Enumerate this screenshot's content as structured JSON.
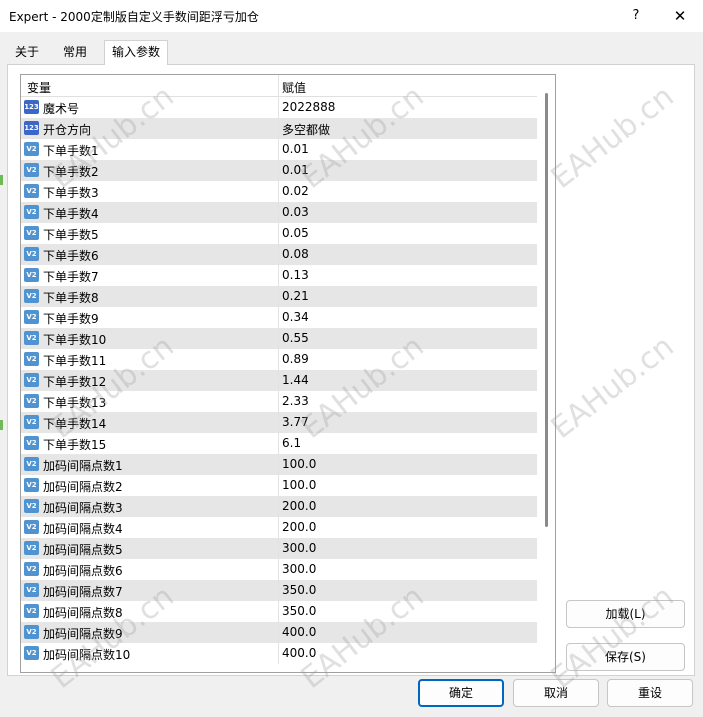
{
  "window": {
    "title": "Expert - 2000定制版自定义手数间距浮亏加仓",
    "help": "?",
    "close": "✕"
  },
  "tabs": [
    {
      "label": "关于"
    },
    {
      "label": "常用"
    },
    {
      "label": "输入参数",
      "active": true
    }
  ],
  "table": {
    "columns": [
      "变量",
      "赋值"
    ],
    "rows": [
      {
        "icon": "int-type-icon",
        "badge": "123",
        "name": "魔术号",
        "value": "2022888"
      },
      {
        "icon": "enum-type-icon",
        "badge": "123",
        "name": "开仓方向",
        "value": "多空都做"
      },
      {
        "icon": "double-type-icon",
        "badge": "V2",
        "name": "下单手数1",
        "value": "0.01"
      },
      {
        "icon": "double-type-icon",
        "badge": "V2",
        "name": "下单手数2",
        "value": "0.01"
      },
      {
        "icon": "double-type-icon",
        "badge": "V2",
        "name": "下单手数3",
        "value": "0.02"
      },
      {
        "icon": "double-type-icon",
        "badge": "V2",
        "name": "下单手数4",
        "value": "0.03"
      },
      {
        "icon": "double-type-icon",
        "badge": "V2",
        "name": "下单手数5",
        "value": "0.05"
      },
      {
        "icon": "double-type-icon",
        "badge": "V2",
        "name": "下单手数6",
        "value": "0.08"
      },
      {
        "icon": "double-type-icon",
        "badge": "V2",
        "name": "下单手数7",
        "value": "0.13"
      },
      {
        "icon": "double-type-icon",
        "badge": "V2",
        "name": "下单手数8",
        "value": "0.21"
      },
      {
        "icon": "double-type-icon",
        "badge": "V2",
        "name": "下单手数9",
        "value": "0.34"
      },
      {
        "icon": "double-type-icon",
        "badge": "V2",
        "name": "下单手数10",
        "value": "0.55"
      },
      {
        "icon": "double-type-icon",
        "badge": "V2",
        "name": "下单手数11",
        "value": "0.89"
      },
      {
        "icon": "double-type-icon",
        "badge": "V2",
        "name": "下单手数12",
        "value": "1.44"
      },
      {
        "icon": "double-type-icon",
        "badge": "V2",
        "name": "下单手数13",
        "value": "2.33"
      },
      {
        "icon": "double-type-icon",
        "badge": "V2",
        "name": "下单手数14",
        "value": "3.77"
      },
      {
        "icon": "double-type-icon",
        "badge": "V2",
        "name": "下单手数15",
        "value": "6.1"
      },
      {
        "icon": "double-type-icon",
        "badge": "V2",
        "name": "加码间隔点数1",
        "value": "100.0"
      },
      {
        "icon": "double-type-icon",
        "badge": "V2",
        "name": "加码间隔点数2",
        "value": "100.0"
      },
      {
        "icon": "double-type-icon",
        "badge": "V2",
        "name": "加码间隔点数3",
        "value": "200.0"
      },
      {
        "icon": "double-type-icon",
        "badge": "V2",
        "name": "加码间隔点数4",
        "value": "200.0"
      },
      {
        "icon": "double-type-icon",
        "badge": "V2",
        "name": "加码间隔点数5",
        "value": "300.0"
      },
      {
        "icon": "double-type-icon",
        "badge": "V2",
        "name": "加码间隔点数6",
        "value": "300.0"
      },
      {
        "icon": "double-type-icon",
        "badge": "V2",
        "name": "加码间隔点数7",
        "value": "350.0"
      },
      {
        "icon": "double-type-icon",
        "badge": "V2",
        "name": "加码间隔点数8",
        "value": "350.0"
      },
      {
        "icon": "double-type-icon",
        "badge": "V2",
        "name": "加码间隔点数9",
        "value": "400.0"
      },
      {
        "icon": "double-type-icon",
        "badge": "V2",
        "name": "加码间隔点数10",
        "value": "400.0"
      }
    ]
  },
  "side_buttons": {
    "load": "加载(L)",
    "save": "保存(S)"
  },
  "footer_buttons": {
    "ok": "确定",
    "cancel": "取消",
    "reset": "重设"
  },
  "watermark": "EAHub.cn",
  "colors": {
    "accent": "#0067c0",
    "row_alt": "#e6e6e6",
    "icon_int": "#3b68c7",
    "icon_double": "#4f93d0"
  }
}
